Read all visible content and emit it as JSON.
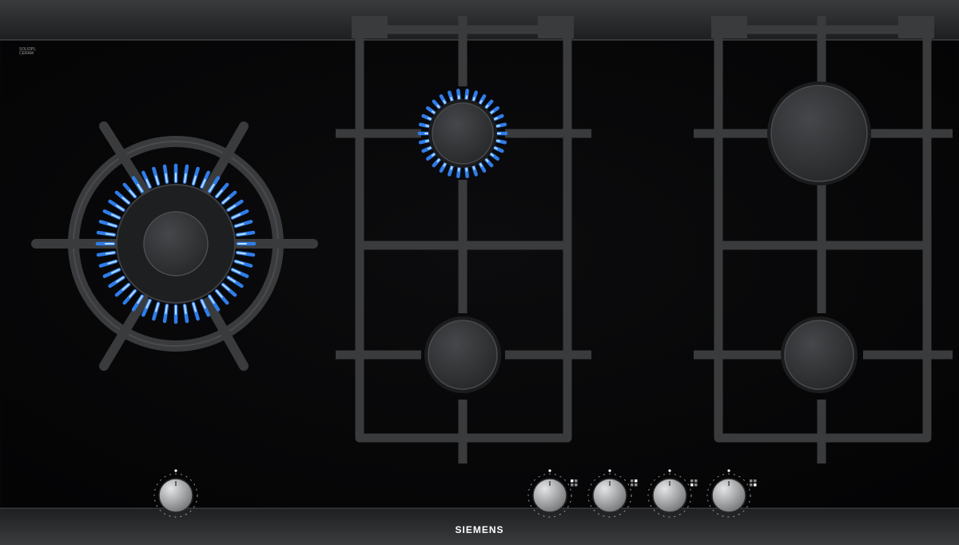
{
  "brand": "SIEMENS",
  "cert_label": [
    "SOLIDPL",
    "CERAM"
  ],
  "colors": {
    "glass": "#060607",
    "frame_top": "#2e2f31",
    "frame_bottom": "#323335",
    "grate": "#3a3b3d",
    "burner_cap": "#2f3033",
    "flame_outer": "#2f7de8",
    "flame_inner": "#9fd0ff",
    "knob_steel": "#a9aaac",
    "brand_text": "#ffffff"
  },
  "icons": {
    "flame": "gas-flame-icon",
    "knob": "control-knob-icon",
    "burner": "burner-cap-icon"
  },
  "burners": [
    {
      "name": "wok-burner",
      "lit": true
    },
    {
      "name": "middle-top-burner",
      "lit": true
    },
    {
      "name": "middle-bottom-burner",
      "lit": false
    },
    {
      "name": "right-top-burner",
      "lit": false
    },
    {
      "name": "right-bottom-burner",
      "lit": false
    }
  ],
  "knobs": [
    {
      "name": "wok-knob"
    },
    {
      "name": "knob-1"
    },
    {
      "name": "knob-2"
    },
    {
      "name": "knob-3"
    },
    {
      "name": "knob-4"
    }
  ]
}
